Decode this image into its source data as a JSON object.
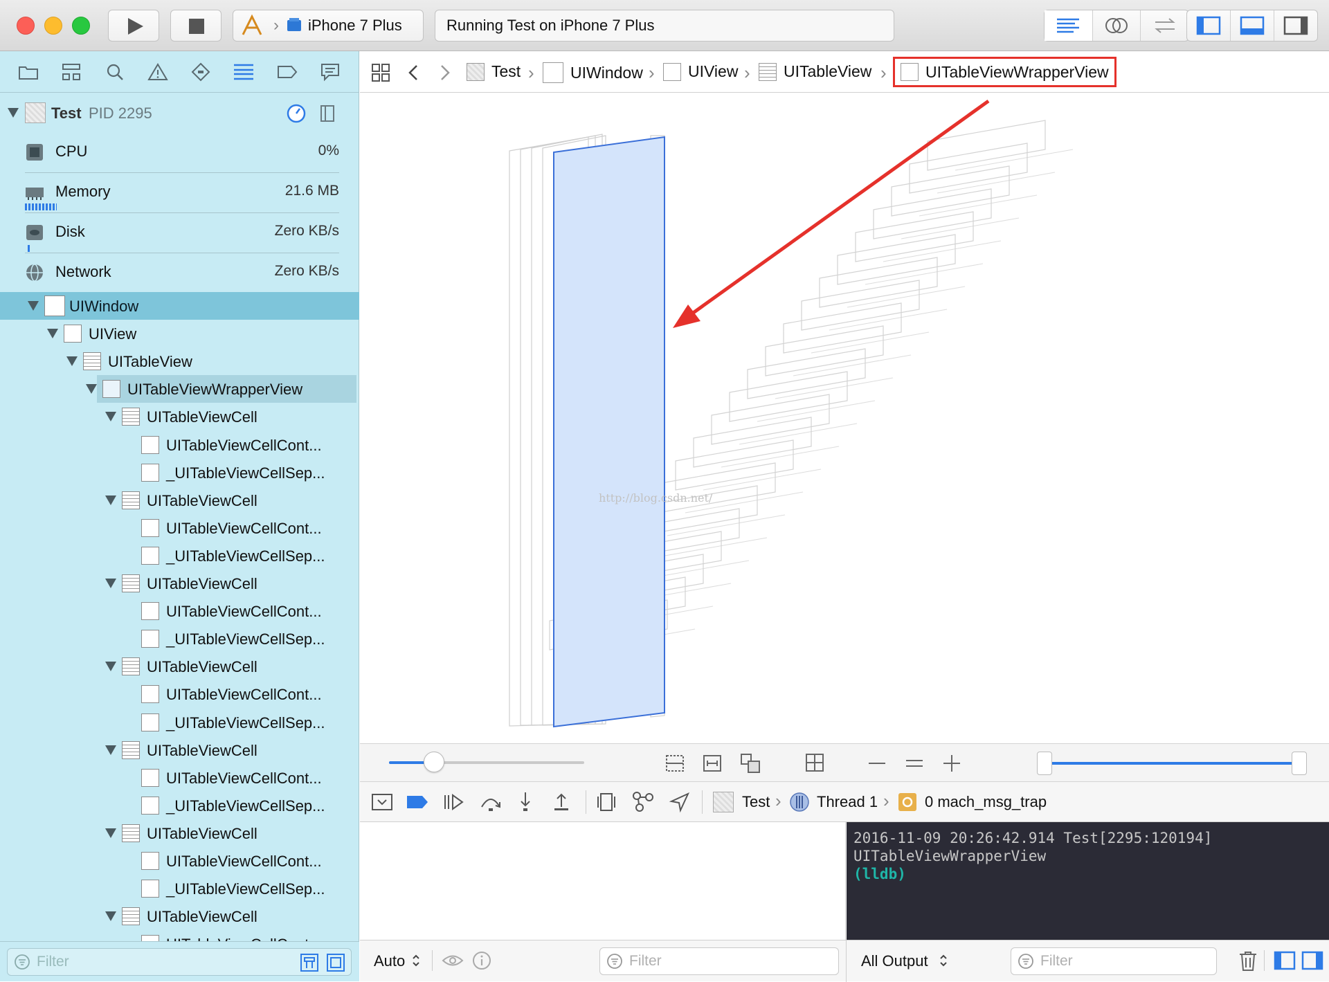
{
  "toolbar": {
    "scheme_target": "iPhone 7 Plus",
    "activity_text": "Running Test on iPhone 7 Plus"
  },
  "navigator": {
    "process": {
      "name": "Test",
      "pid": "PID 2295"
    },
    "gauges": [
      {
        "name": "CPU",
        "value": "0%"
      },
      {
        "name": "Memory",
        "value": "21.6 MB"
      },
      {
        "name": "Disk",
        "value": "Zero KB/s"
      },
      {
        "name": "Network",
        "value": "Zero KB/s"
      }
    ],
    "tree": [
      "UIWindow",
      "UIView",
      "UITableView",
      "UITableViewWrapperView",
      "UITableViewCell",
      "UITableViewCellCont...",
      "_UITableViewCellSep...",
      "UITableViewCell",
      "UITableViewCellCont...",
      "_UITableViewCellSep...",
      "UITableViewCell",
      "UITableViewCellCont...",
      "_UITableViewCellSep...",
      "UITableViewCell",
      "UITableViewCellCont...",
      "_UITableViewCellSep...",
      "UITableViewCell",
      "UITableViewCellCont...",
      "_UITableViewCellSep...",
      "UITableViewCell",
      "UITableViewCellCont...",
      "_UITableViewCellSep...",
      "UITableViewCell",
      "UITableViewCellCont..."
    ],
    "filter_placeholder": "Filter"
  },
  "jumpbar": {
    "items": [
      "Test",
      "UIWindow",
      "UIView",
      "UITableView",
      "UITableViewWrapperView"
    ]
  },
  "canvas": {
    "watermark": "http://blog.csdn.net/",
    "highlight_color": "#e5312b",
    "selection_color": "#3a6fd8"
  },
  "debugbar": {
    "process": "Test",
    "thread": "Thread 1",
    "frame": "0 mach_msg_trap"
  },
  "console": {
    "line1": "2016-11-09 20:26:42.914 Test[2295:120194]",
    "line2": "UITableViewWrapperView",
    "prompt": "(lldb)"
  },
  "bottom": {
    "auto_label": "Auto",
    "vars_filter": "Filter",
    "output_label": "All Output",
    "console_filter": "Filter"
  }
}
